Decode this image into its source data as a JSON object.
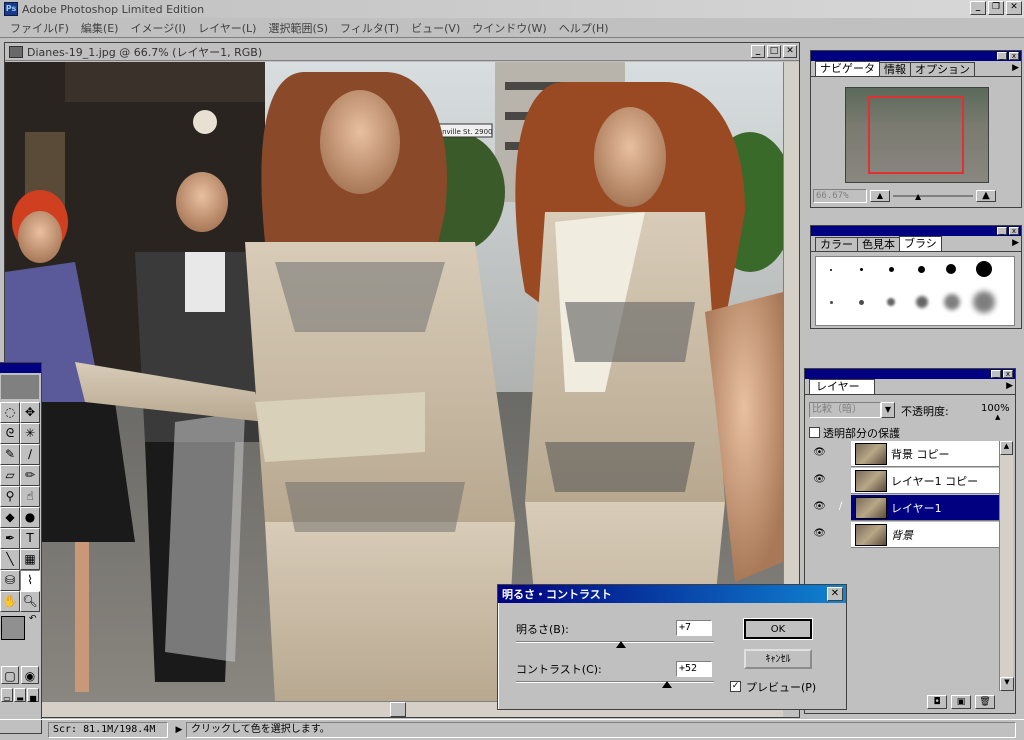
{
  "app": {
    "title": "Adobe Photoshop Limited Edition",
    "icon_name": "photoshop-app-icon"
  },
  "window_buttons": {
    "minimize": "_",
    "maximize": "❐",
    "close": "✕"
  },
  "menu": [
    "ファイル(F)",
    "編集(E)",
    "イメージ(I)",
    "レイヤー(L)",
    "選択範囲(S)",
    "フィルタ(T)",
    "ビュー(V)",
    "ウインドウ(W)",
    "ヘルプ(H)"
  ],
  "document": {
    "title": "Dianes-19_1.jpg @ 66.7% (レイヤー1, RGB)",
    "sign_text": "Granville St. 2900"
  },
  "navigator": {
    "tabs": [
      "ナビゲータ",
      "情報",
      "オプション"
    ],
    "zoom_value": "66.67%"
  },
  "color_panel": {
    "tabs": [
      "カラー",
      "色見本",
      "ブラシ"
    ]
  },
  "layers": {
    "tab": "レイヤー",
    "blend_mode": "比較（暗）",
    "opacity_label": "不透明度:",
    "opacity_value": "100%",
    "preserve_label": "透明部分の保護",
    "items": [
      {
        "name": "背景 コピー",
        "active": false
      },
      {
        "name": "レイヤー1 コピー",
        "active": false
      },
      {
        "name": "レイヤー1",
        "active": true
      },
      {
        "name": "背景",
        "active": false
      }
    ]
  },
  "dialog": {
    "title": "明るさ・コントラスト",
    "brightness_label": "明るさ(B):",
    "brightness_value": "+7",
    "contrast_label": "コントラスト(C):",
    "contrast_value": "+52",
    "ok_label": "OK",
    "cancel_label": "ｷｬﾝｾﾙ",
    "preview_label": "プレビュー(P)",
    "preview_checked": true
  },
  "status": {
    "scratch": "Scr: 81.1M/198.4M",
    "hint": "クリックして色を選択します。"
  },
  "colors": {
    "title_active": "#000080",
    "chrome": "#c0c0c0"
  }
}
